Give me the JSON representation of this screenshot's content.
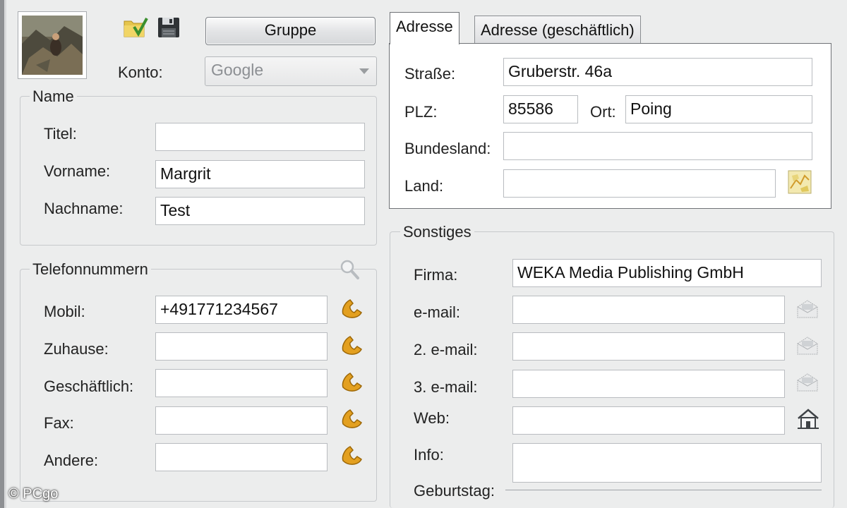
{
  "toolbar": {
    "group_button": "Gruppe",
    "account_label": "Konto:",
    "account_value": "Google"
  },
  "name_group": {
    "title": "Name",
    "fields": [
      {
        "label": "Titel:",
        "value": ""
      },
      {
        "label": "Vorname:",
        "value": "Margrit"
      },
      {
        "label": "Nachname:",
        "value": "Test"
      }
    ]
  },
  "phone_group": {
    "title": "Telefonnummern",
    "fields": [
      {
        "label": "Mobil:",
        "value": "+491771234567"
      },
      {
        "label": "Zuhause:",
        "value": ""
      },
      {
        "label": "Geschäftlich:",
        "value": ""
      },
      {
        "label": "Fax:",
        "value": ""
      },
      {
        "label": "Andere:",
        "value": ""
      }
    ]
  },
  "address_tabs": {
    "tabs": [
      "Adresse",
      "Adresse (geschäftlich)"
    ],
    "active": "Adresse",
    "street_label": "Straße:",
    "street_value": "Gruberstr. 46a",
    "zip_label": "PLZ:",
    "zip_value": "85586",
    "city_label": "Ort:",
    "city_value": "Poing",
    "state_label": "Bundesland:",
    "state_value": "",
    "country_label": "Land:",
    "country_value": ""
  },
  "misc_group": {
    "title": "Sonstiges",
    "company_label": "Firma:",
    "company_value": "WEKA Media Publishing GmbH",
    "email1_label": "e-mail:",
    "email1_value": "",
    "email2_label": "2. e-mail:",
    "email2_value": "",
    "email3_label": "3. e-mail:",
    "email3_value": "",
    "web_label": "Web:",
    "web_value": "",
    "info_label": "Info:",
    "info_value": "",
    "birthday_label": "Geburtstag:"
  },
  "watermark": "© PCgo",
  "icons": {
    "photo": "contact-photo",
    "folder": "folder-check-icon",
    "save": "save-icon",
    "search": "search-icon",
    "phone": "phone-icon",
    "email": "envelope-icon",
    "web": "house-icon",
    "map": "map-icon"
  }
}
